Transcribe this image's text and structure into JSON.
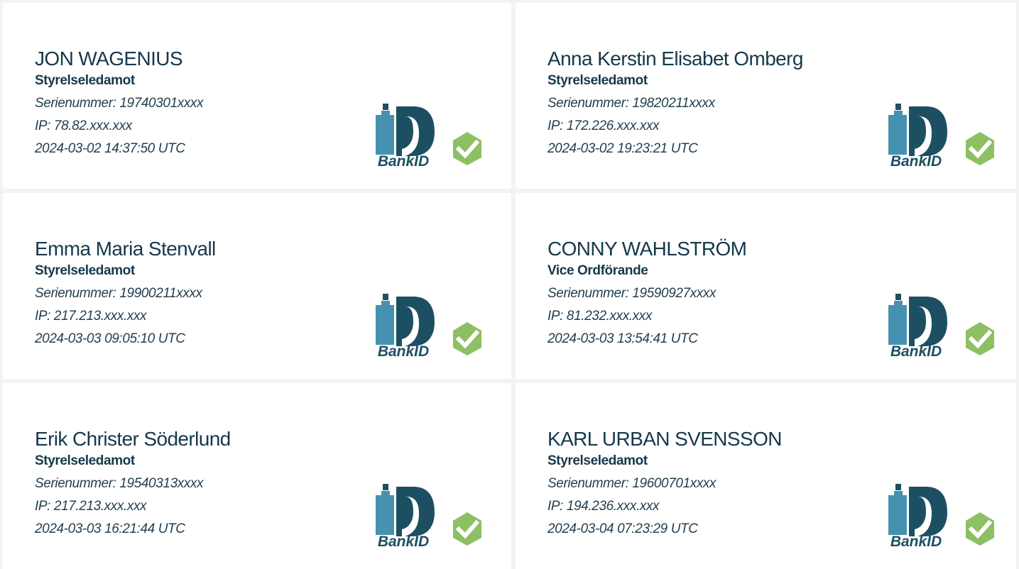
{
  "brand": {
    "logo_text": "BankID",
    "logo_color_dark": "#1d4f63",
    "logo_color_light": "#4791b0",
    "verified_color": "#8cc063"
  },
  "signers": [
    {
      "name": "JON WAGENIUS",
      "role": "Styrelseledamot",
      "serial": "Serienummer: 19740301xxxx",
      "ip": "IP: 78.82.xxx.xxx",
      "timestamp": "2024-03-02 14:37:50 UTC",
      "verified_icon": "checkmark-hexagon-icon"
    },
    {
      "name": "Anna Kerstin Elisabet Omberg",
      "role": "Styrelseledamot",
      "serial": "Serienummer: 19820211xxxx",
      "ip": "IP: 172.226.xxx.xxx",
      "timestamp": "2024-03-02 19:23:21 UTC",
      "verified_icon": "checkmark-hexagon-icon"
    },
    {
      "name": "Emma Maria Stenvall",
      "role": "Styrelseledamot",
      "serial": "Serienummer: 19900211xxxx",
      "ip": "IP: 217.213.xxx.xxx",
      "timestamp": "2024-03-03 09:05:10 UTC",
      "verified_icon": "checkmark-hexagon-icon"
    },
    {
      "name": "CONNY WAHLSTRÖM",
      "role": "Vice Ordförande",
      "serial": "Serienummer: 19590927xxxx",
      "ip": "IP: 81.232.xxx.xxx",
      "timestamp": "2024-03-03 13:54:41 UTC",
      "verified_icon": "checkmark-hexagon-icon"
    },
    {
      "name": "Erik Christer Söderlund",
      "role": "Styrelseledamot",
      "serial": "Serienummer: 19540313xxxx",
      "ip": "IP: 217.213.xxx.xxx",
      "timestamp": "2024-03-03 16:21:44 UTC",
      "verified_icon": "checkmark-hexagon-icon"
    },
    {
      "name": "KARL URBAN SVENSSON",
      "role": "Styrelseledamot",
      "serial": "Serienummer: 19600701xxxx",
      "ip": "IP: 194.236.xxx.xxx",
      "timestamp": "2024-03-04 07:23:29 UTC",
      "verified_icon": "checkmark-hexagon-icon"
    }
  ]
}
